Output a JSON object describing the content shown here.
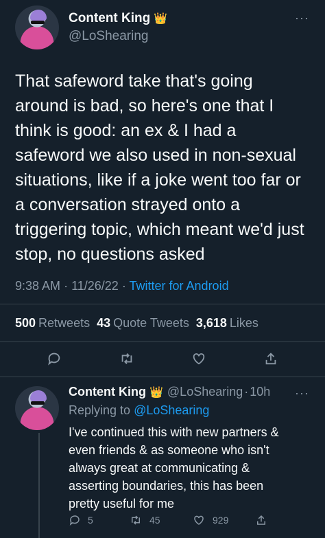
{
  "tweet": {
    "author_name": "Content King",
    "author_emoji": "👑",
    "author_handle": "@LoShearing",
    "text": "That safeword take that's going around is bad, so here's one that I think is good: an ex & I had a safeword we also used in non-sexual situations, like if a joke went too far or a conversation strayed onto a triggering topic, which meant we'd just stop, no questions asked",
    "time": "9:38 AM",
    "date": "11/26/22",
    "separator": "·",
    "source": "Twitter for Android",
    "stats": {
      "retweets_count": "500",
      "retweets_label": "Retweets",
      "quotes_count": "43",
      "quotes_label": "Quote Tweets",
      "likes_count": "3,618",
      "likes_label": "Likes"
    },
    "more_icon": "···"
  },
  "reply": {
    "author_name": "Content King",
    "author_emoji": "👑",
    "author_handle": "@LoShearing",
    "separator": "·",
    "age": "10h",
    "replying_prefix": "Replying to",
    "replying_handle": "@LoShearing",
    "text": "I've continued this with new partners & even friends & as someone who isn't always great at communicating & asserting boundaries, this has been pretty useful for me",
    "replies_count": "5",
    "retweets_count": "45",
    "likes_count": "929",
    "more_icon": "···"
  },
  "colors": {
    "background": "#15202b",
    "text": "#f7f9f9",
    "muted": "#8b98a5",
    "link": "#1d9bf0",
    "divider": "#38444d"
  }
}
